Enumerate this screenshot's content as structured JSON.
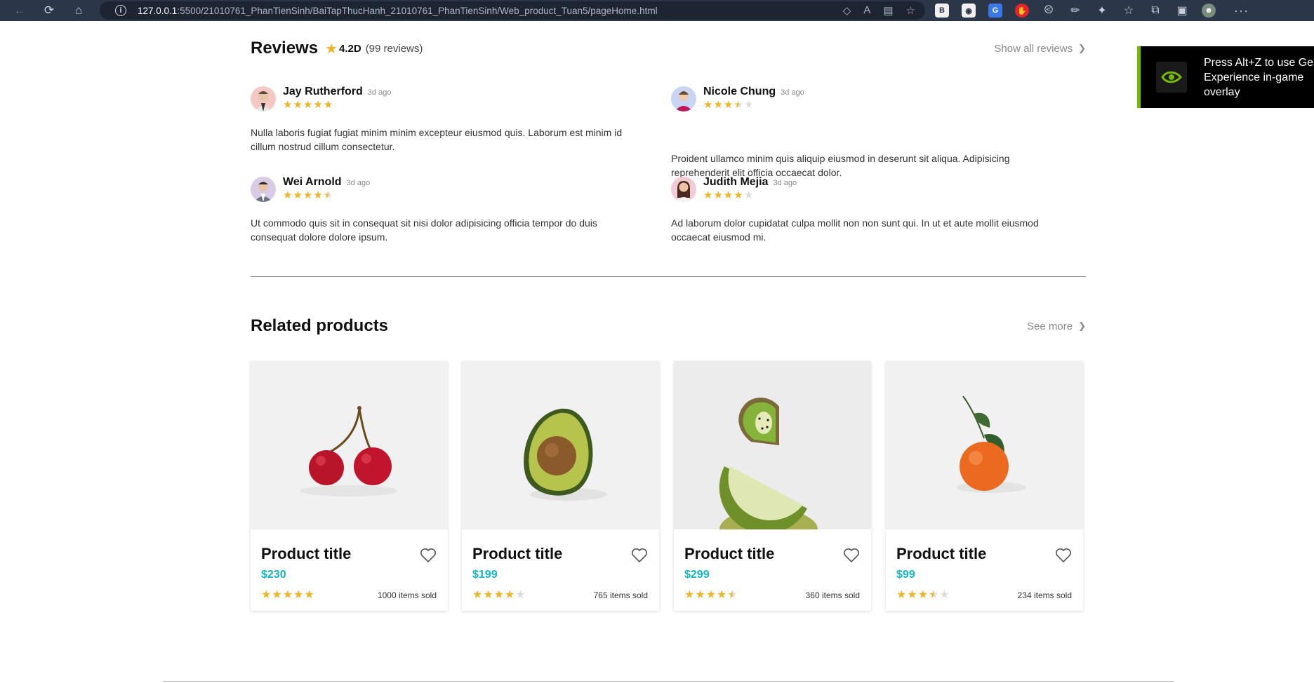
{
  "browser": {
    "url_host": "127.0.0.1",
    "url_path": ":5500/21010761_PhanTienSinh/BaiTapThucHanh_21010761_PhanTienSinh/Web_product_Tuan5/pageHome.html"
  },
  "overlay": {
    "text_line1": "Press Alt+Z to use GeF",
    "text_line2": "Experience in-game",
    "text_line3": "overlay"
  },
  "reviews": {
    "title": "Reviews",
    "rating": "4.2D",
    "count_text": "(99 reviews)",
    "show_all_label": "Show all reviews",
    "items": [
      {
        "name": "Jay Rutherford",
        "time": "3d ago",
        "rating": 5,
        "text": "Nulla laboris fugiat fugiat minim minim excepteur eiusmod quis. Laborum est minim id cillum nostrud cillum consectetur."
      },
      {
        "name": "Nicole Chung",
        "time": "3d ago",
        "rating": 3.5,
        "text": "Proident ullamco minim quis aliquip eiusmod in deserunt sit aliqua. Adipisicing reprehenderit elit officia occaecat dolor."
      },
      {
        "name": "Wei Arnold",
        "time": "3d ago",
        "rating": 4.5,
        "text": "Ut commodo quis sit in consequat sit nisi dolor adipisicing officia tempor do duis consequat dolore dolore ipsum."
      },
      {
        "name": "Judith Mejia",
        "time": "3d ago",
        "rating": 4,
        "text": "Ad laborum dolor cupidatat culpa mollit non non sunt qui. In ut et aute mollit eiusmod occaecat eiusmod mi."
      }
    ]
  },
  "related": {
    "title": "Related products",
    "see_more_label": "See more",
    "products": [
      {
        "title": "Product title",
        "price": "$230",
        "rating": 5,
        "sold": "1000 items sold",
        "image": "cherries"
      },
      {
        "title": "Product title",
        "price": "$199",
        "rating": 4,
        "sold": "765 items sold",
        "image": "avocado"
      },
      {
        "title": "Product title",
        "price": "$299",
        "rating": 4.5,
        "sold": "360 items sold",
        "image": "kiwi-lime"
      },
      {
        "title": "Product title",
        "price": "$99",
        "rating": 3.5,
        "sold": "234 items sold",
        "image": "tangerine"
      }
    ]
  },
  "colors": {
    "accent_price": "#12b5c9",
    "star": "#f0b429",
    "nvidia_green": "#76b900"
  },
  "icons": [
    "back-icon",
    "refresh-icon",
    "home-icon",
    "info-icon",
    "star-icon",
    "heart-icon",
    "chevron-right-icon"
  ]
}
